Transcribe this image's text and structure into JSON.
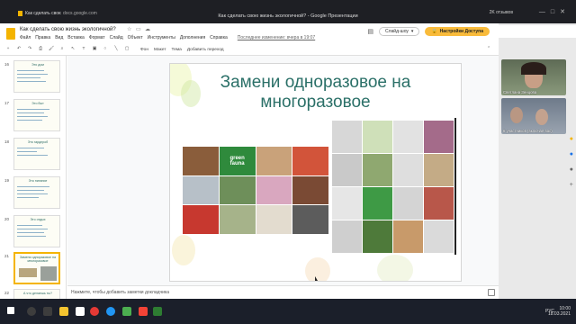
{
  "browser": {
    "tab_label": "Как сделать свою жизнь экологичной? - Google Презентации",
    "url": "docs.google.com",
    "window_title": "Как сделать свою жизнь экологичной? - Google Презентации",
    "viewers_label": "2K отзывов"
  },
  "docs": {
    "doc_title": "Как сделать свою жизнь экологичной?",
    "menu": [
      "Файл",
      "Правка",
      "Вид",
      "Вставка",
      "Формат",
      "Слайд",
      "Объект",
      "Инструменты",
      "Дополнения",
      "Справка"
    ],
    "last_edit": "Последнее изменение: вчера в 19:07",
    "present_label": "Слайд-шоу",
    "share_label": "Настройки Доступа",
    "toolbar": {
      "background": "Фон",
      "layout": "Макет",
      "theme": "Тема",
      "transition": "Добавить переход"
    }
  },
  "filmstrip": [
    {
      "num": "16",
      "title": "Это дом"
    },
    {
      "num": "17",
      "title": "Это быт"
    },
    {
      "num": "18",
      "title": "Это гардероб"
    },
    {
      "num": "19",
      "title": "Это питание"
    },
    {
      "num": "20",
      "title": "Это отдых"
    },
    {
      "num": "21",
      "title": "Замени одноразовое на многоразовое"
    },
    {
      "num": "22",
      "title": "А что делаешь ты?"
    }
  ],
  "slide": {
    "title": "Замени одноразовое на многоразовое",
    "logo_line1": "green",
    "logo_line2": "fauna"
  },
  "notes": {
    "placeholder": "Нажмите, чтобы добавить заметки докладчика"
  },
  "video": {
    "participant1": "Светлана Зенцова",
    "participant2": "6 участников (включая вас)"
  },
  "taskbar": {
    "time": "10:00",
    "date": "18.03.2021",
    "lang": "РУС"
  },
  "colors": {
    "title_teal": "#2b7068",
    "share_yellow": "#f9bb3b",
    "active_slide": "#f4b400"
  }
}
